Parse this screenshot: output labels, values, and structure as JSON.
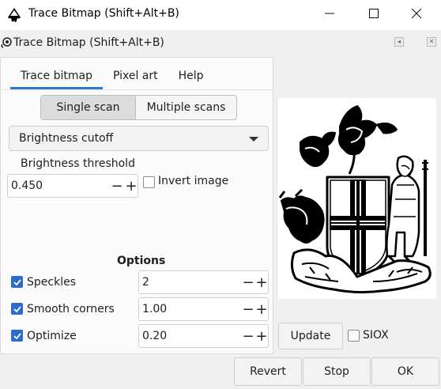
{
  "window": {
    "title": "Trace Bitmap (Shift+Alt+B)",
    "controls": {
      "minimize": "minimize-icon",
      "maximize": "maximize-icon",
      "close": "close-icon"
    }
  },
  "dock": {
    "title": "Trace Bitmap (Shift+Alt+B)",
    "icon": "trace-bitmap-icon"
  },
  "tabs": [
    {
      "label": "Trace bitmap",
      "active": true
    },
    {
      "label": "Pixel art",
      "active": false
    },
    {
      "label": "Help",
      "active": false
    }
  ],
  "scan_mode": {
    "options": [
      "Single scan",
      "Multiple scans"
    ],
    "selected": "Single scan"
  },
  "mode_dropdown": {
    "value": "Brightness cutoff"
  },
  "threshold": {
    "label": "Brightness threshold",
    "value": "0.450",
    "invert_label": "Invert image",
    "invert_checked": false
  },
  "options": {
    "title": "Options",
    "items": [
      {
        "label": "Speckles",
        "checked": true,
        "value": "2"
      },
      {
        "label": "Smooth corners",
        "checked": true,
        "value": "1.00"
      },
      {
        "label": "Optimize",
        "checked": true,
        "value": "0.20"
      }
    ]
  },
  "preview": {
    "update_label": "Update",
    "siox_label": "SIOX",
    "siox_checked": false
  },
  "footer": {
    "revert_label": "Revert",
    "stop_label": "Stop",
    "ok_label": "OK"
  },
  "colors": {
    "accent": "#2b78cf",
    "checkbox_checked": "#2b6ccc",
    "window_bg": "#f0f0f0"
  }
}
